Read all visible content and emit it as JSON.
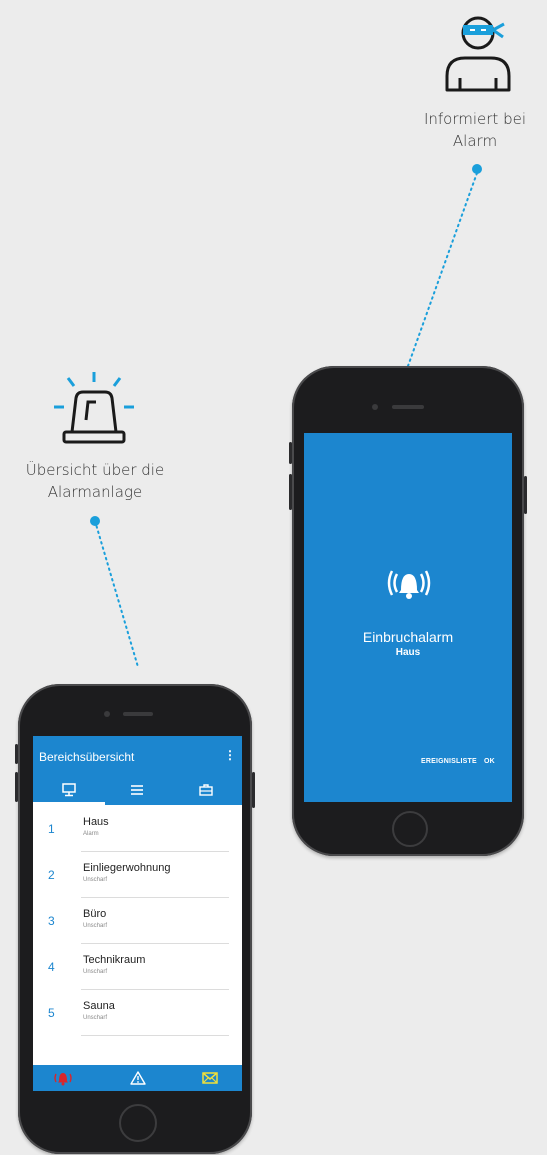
{
  "callouts": {
    "burglar": {
      "caption_line1": "Informiert bei",
      "caption_line2": "Alarm",
      "icon": "burglar-icon"
    },
    "siren": {
      "caption_line1": "Übersicht über die",
      "caption_line2": "Alarmanlage",
      "icon": "siren-light-icon"
    }
  },
  "colors": {
    "accent": "#1a9fdb",
    "app_blue": "#1c86cf",
    "alarm_red": "#d9262b",
    "warning_yellow": "#f2e03a"
  },
  "alarm_screen": {
    "title": "Einbruchalarm",
    "subtitle": "Haus",
    "buttons": {
      "event_list": "EREIGNISLISTE",
      "ok": "OK"
    },
    "icon": "alarm-bell-icon"
  },
  "area_screen": {
    "title": "Bereichsübersicht",
    "menu_icon": "⋮",
    "tabs": [
      {
        "icon": "monitor-icon",
        "active": true
      },
      {
        "icon": "list-icon",
        "active": false
      },
      {
        "icon": "toolbox-icon",
        "active": false
      }
    ],
    "areas": [
      {
        "number": "1",
        "name": "Haus",
        "status": "Alarm"
      },
      {
        "number": "2",
        "name": "Einliegerwohnung",
        "status": "Unscharf"
      },
      {
        "number": "3",
        "name": "Büro",
        "status": "Unscharf"
      },
      {
        "number": "4",
        "name": "Technikraum",
        "status": "Unscharf"
      },
      {
        "number": "5",
        "name": "Sauna",
        "status": "Unscharf"
      }
    ],
    "bottom_bar": [
      {
        "icon": "alarm-bell-icon"
      },
      {
        "icon": "warning-icon"
      },
      {
        "icon": "mail-icon"
      }
    ]
  }
}
